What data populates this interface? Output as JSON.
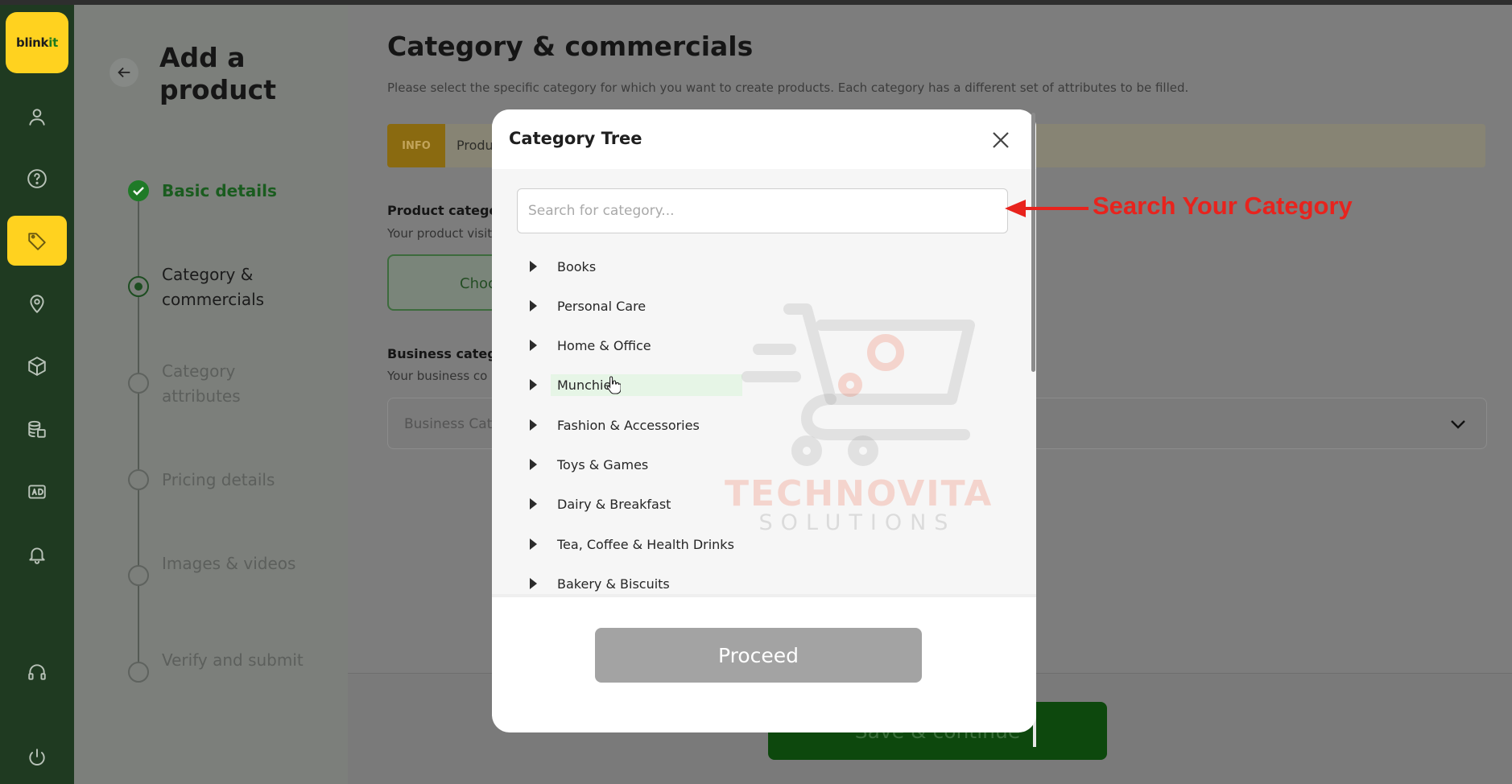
{
  "logo": {
    "text_main": "blink",
    "text_accent": "it"
  },
  "rail_icons": [
    "user-icon",
    "help-circle-icon",
    "tag-icon",
    "location-pin-icon",
    "box-icon",
    "coins-icon",
    "ad-icon",
    "bell-icon",
    "headset-icon",
    "power-icon"
  ],
  "header": {
    "page_title": "Add a product"
  },
  "steps": [
    {
      "label": "Basic details",
      "state": "done"
    },
    {
      "label": "Category & commercials",
      "state": "current"
    },
    {
      "label": "Category attributes",
      "state": "pending"
    },
    {
      "label": "Pricing details",
      "state": "pending"
    },
    {
      "label": "Images & videos",
      "state": "pending"
    },
    {
      "label": "Verify and submit",
      "state": "pending"
    }
  ],
  "main": {
    "title": "Category & commercials",
    "description": "Please select the specific category for which you want to create products. Each category has a different set of attributes to be filled.",
    "info_tag": "INFO",
    "info_text": "Produ",
    "product_category_label": "Product categor",
    "product_category_sub": "Your product visit",
    "choose_button": "Choc",
    "business_category_label": "Business catego",
    "business_category_sub": "Your business co",
    "business_select_placeholder": "Business Cate",
    "save_button": "Save & continue"
  },
  "modal": {
    "title": "Category Tree",
    "search_placeholder": "Search for category...",
    "categories": [
      "Books",
      "Personal Care",
      "Home & Office",
      "Munchies",
      "Fashion & Accessories",
      "Toys & Games",
      "Dairy & Breakfast",
      "Tea, Coffee & Health Drinks",
      "Bakery & Biscuits"
    ],
    "hovered_category": "Munchies",
    "proceed_button": "Proceed"
  },
  "watermark": {
    "title": "TECHNOVITA",
    "subtitle": "SOLUTIONS"
  },
  "annotation": {
    "text": "Search Your Category",
    "color": "#e8231d"
  },
  "colors": {
    "brand_yellow": "#ffd21f",
    "brand_green": "#1f7a27",
    "sidebar": "#1f3a21"
  }
}
